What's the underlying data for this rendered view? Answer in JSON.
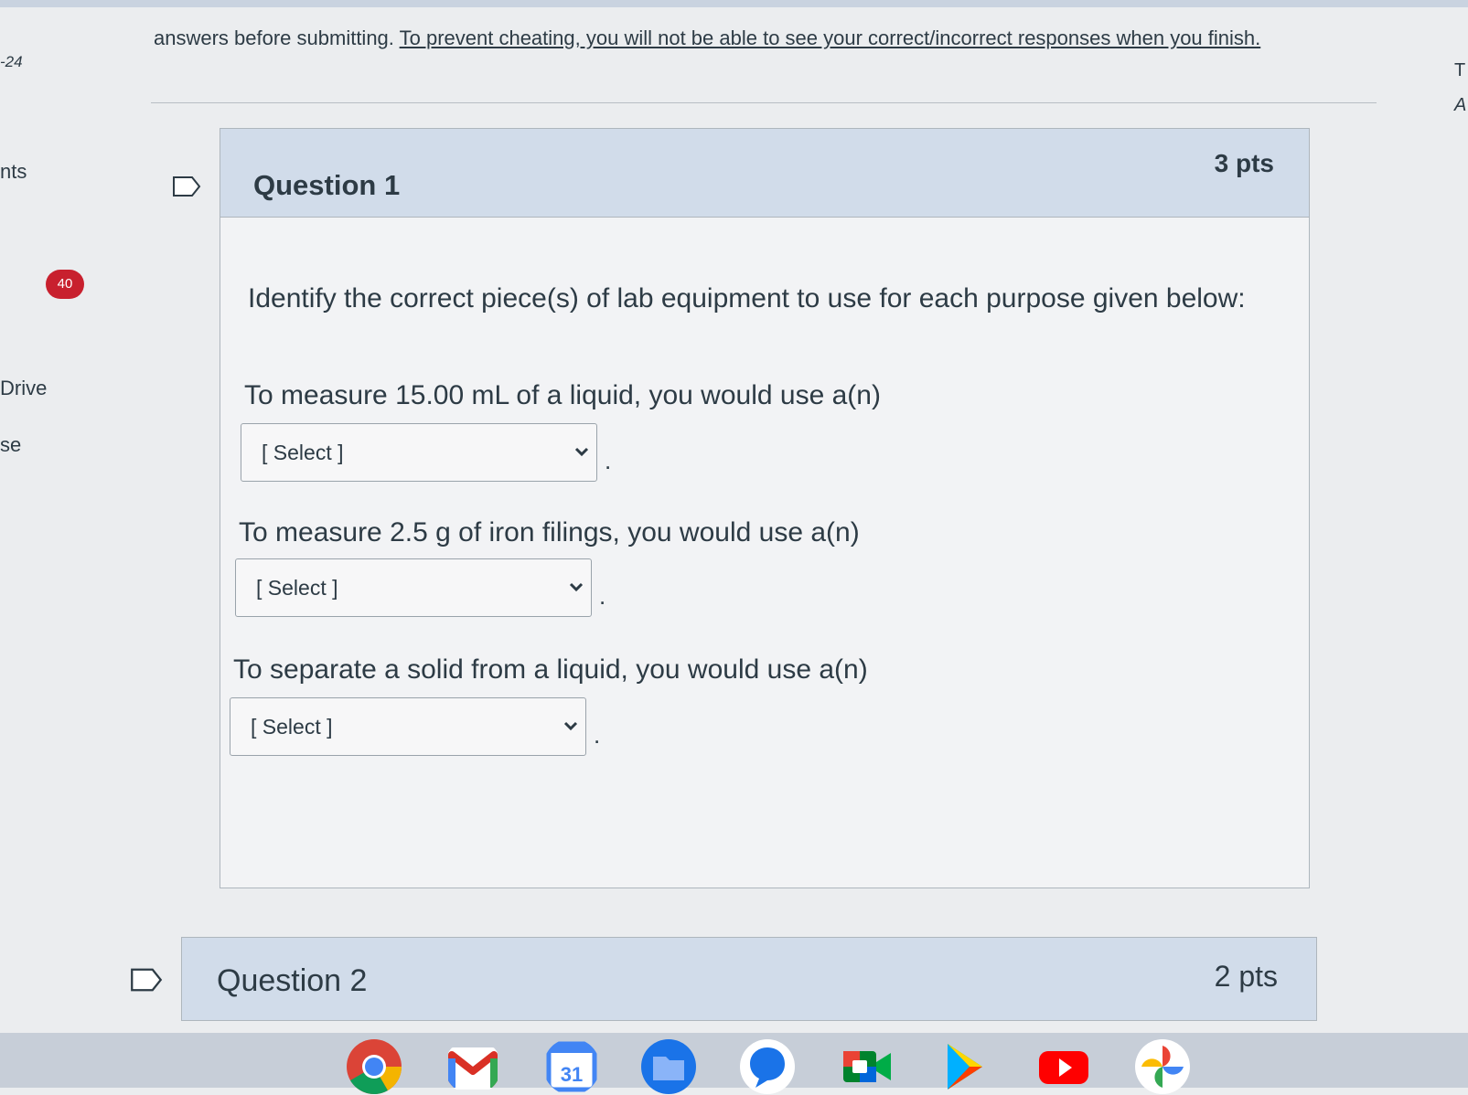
{
  "leftnav": {
    "item_date": "-24",
    "item_nts": "nts",
    "badge": "40",
    "item_drive": "Drive",
    "item_se": "se"
  },
  "right_edge": {
    "t": "T",
    "a": "A"
  },
  "instructions": {
    "plain": "answers before submitting. ",
    "underlined": "To prevent cheating, you will not be able to see your correct/incorrect responses when you finish."
  },
  "question1": {
    "title": "Question 1",
    "points": "3 pts",
    "prompt": "Identify the correct piece(s) of lab equipment to use for each purpose given below:",
    "items": [
      {
        "text": "To measure 15.00 mL of a liquid, you would use a(n)",
        "select": "[ Select ]"
      },
      {
        "text": "To measure 2.5 g of iron filings, you would use a(n)",
        "select": "[ Select ]"
      },
      {
        "text": "To separate a solid from a liquid, you would use a(n)",
        "select": "[ Select ]"
      }
    ],
    "period": "."
  },
  "question2": {
    "title": "Question 2",
    "points": "2 pts"
  },
  "shelf": {
    "apps": [
      "chrome-icon",
      "gmail-icon",
      "calendar-icon",
      "files-icon",
      "messages-icon",
      "meet-icon",
      "play-store-icon",
      "youtube-icon",
      "photos-icon"
    ],
    "calendar_day": "31"
  },
  "colors": {
    "header_bg": "#d1dcea",
    "badge_red": "#c8202e",
    "text": "#2d3b45"
  }
}
